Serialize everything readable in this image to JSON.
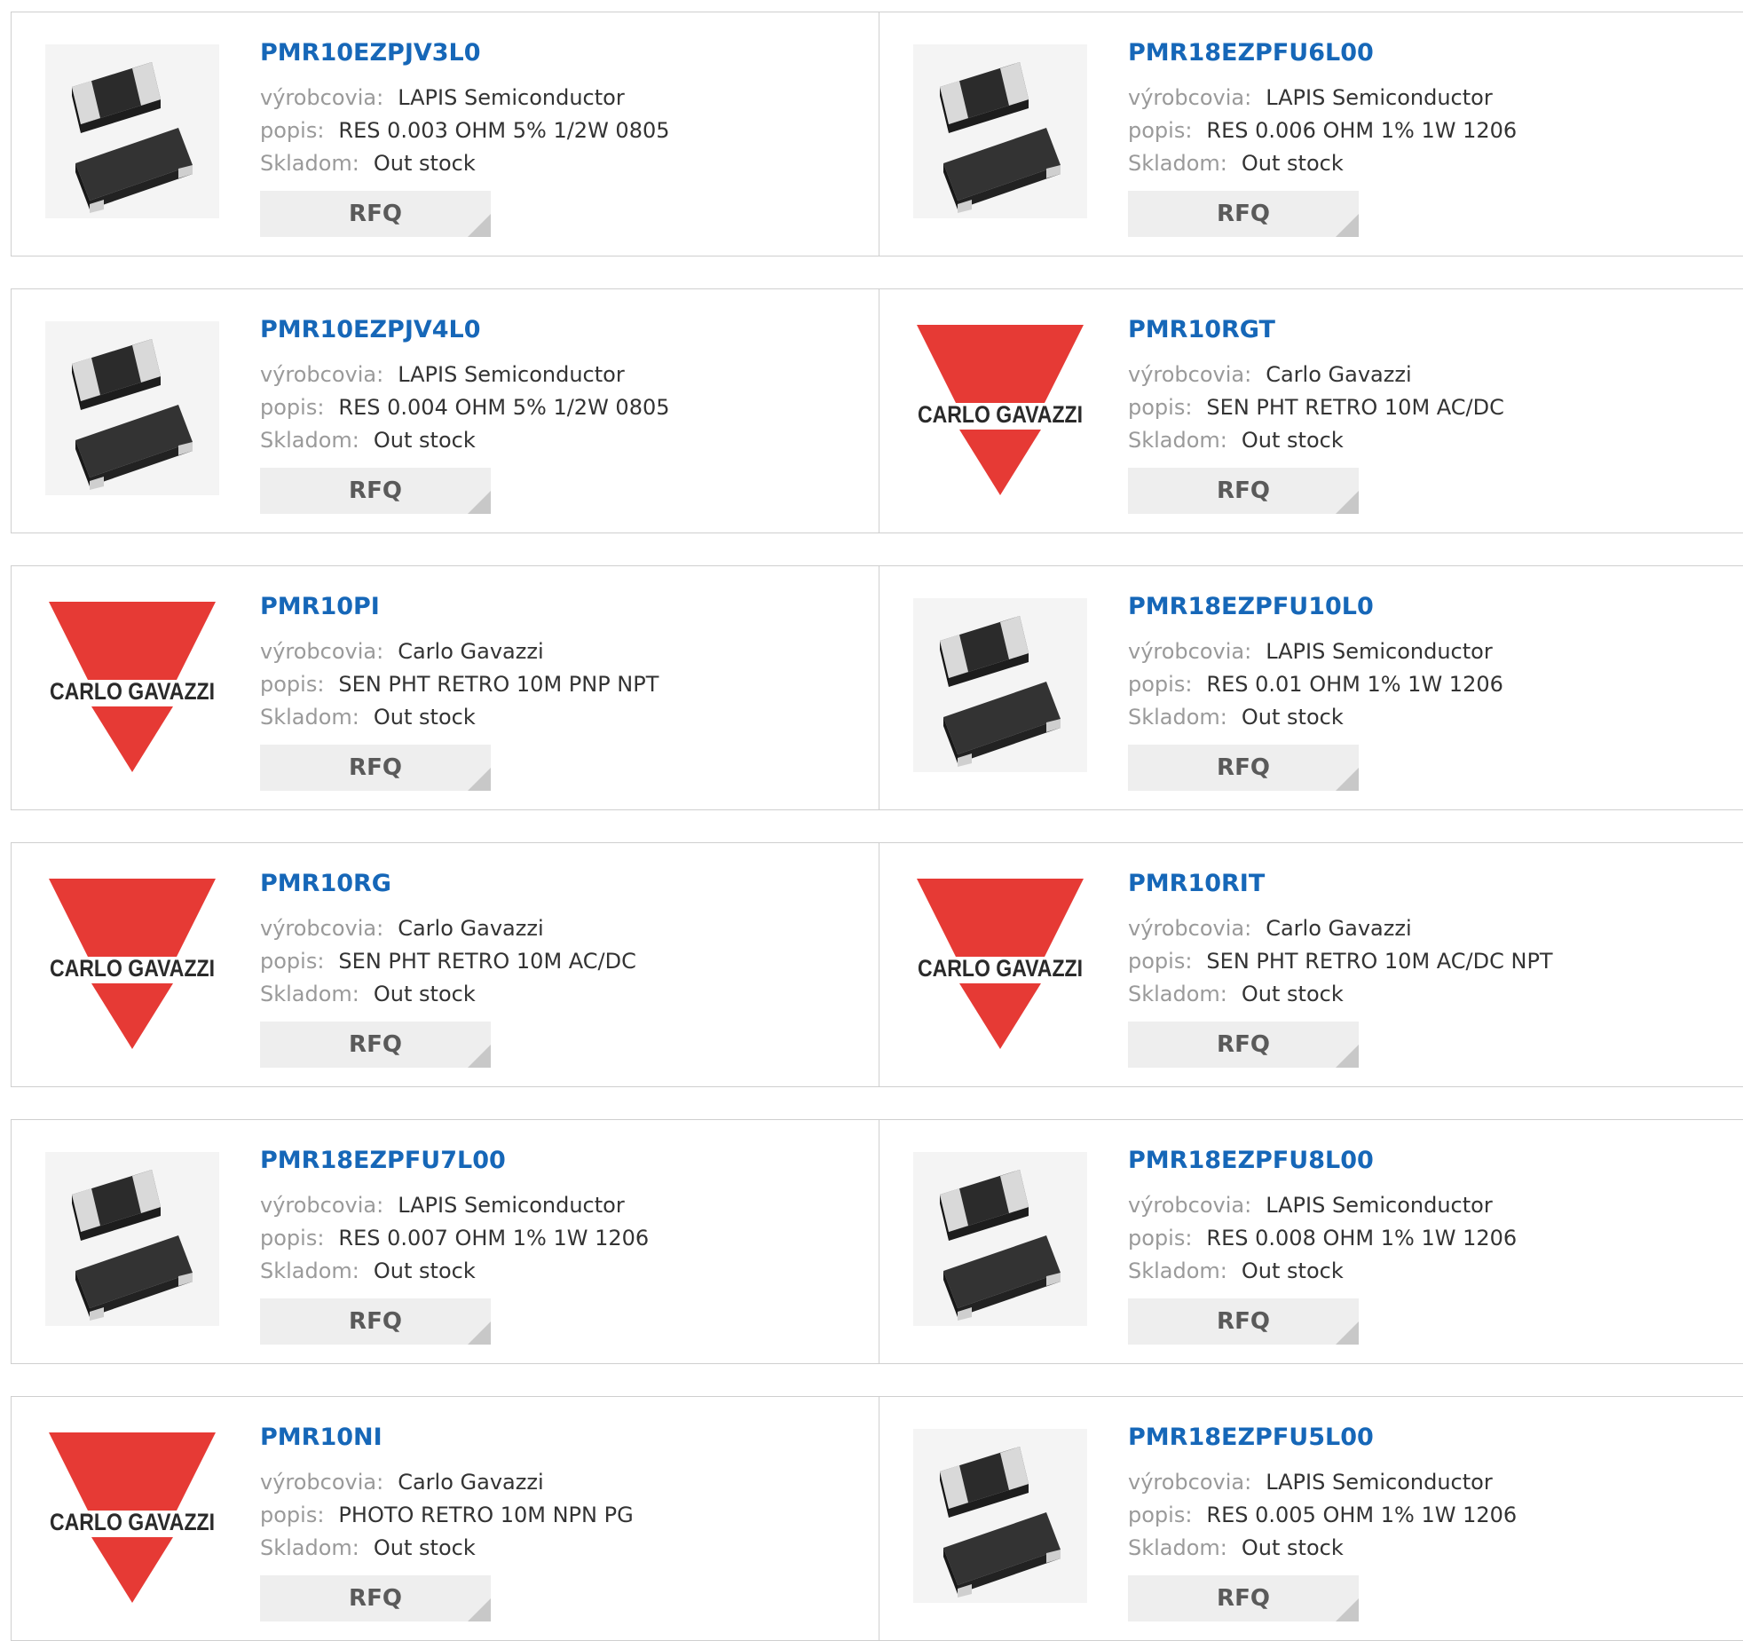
{
  "labels": {
    "manufacturer": "výrobcovia:",
    "description": "popis:",
    "stock": "Skladom:",
    "rfq": "RFQ"
  },
  "brand_colors": {
    "link": "#1667b8",
    "carlo_gavazzi_red": "#e63a35",
    "button_bg": "#eeeeee"
  },
  "products": [
    {
      "part": "PMR10EZPJV3L0",
      "manufacturer": "LAPIS Semiconductor",
      "description": "RES 0.003 OHM 5% 1/2W 0805",
      "stock": "Out stock",
      "image": "smd-resistor-image"
    },
    {
      "part": "PMR18EZPFU6L00",
      "manufacturer": "LAPIS Semiconductor",
      "description": "RES 0.006 OHM 1% 1W 1206",
      "stock": "Out stock",
      "image": "smd-resistor-image"
    },
    {
      "part": "PMR10EZPJV4L0",
      "manufacturer": "LAPIS Semiconductor",
      "description": "RES 0.004 OHM 5% 1/2W 0805",
      "stock": "Out stock",
      "image": "smd-resistor-image"
    },
    {
      "part": "PMR10RGT",
      "manufacturer": "Carlo Gavazzi",
      "description": "SEN PHT RETRO 10M AC/DC",
      "stock": "Out stock",
      "image": "carlo-gavazzi-logo",
      "logo_text": "CARLO GAVAZZI"
    },
    {
      "part": "PMR10PI",
      "manufacturer": "Carlo Gavazzi",
      "description": "SEN PHT RETRO 10M PNP NPT",
      "stock": "Out stock",
      "image": "carlo-gavazzi-logo",
      "logo_text": "CARLO GAVAZZI"
    },
    {
      "part": "PMR18EZPFU10L0",
      "manufacturer": "LAPIS Semiconductor",
      "description": "RES 0.01 OHM 1% 1W 1206",
      "stock": "Out stock",
      "image": "smd-resistor-image"
    },
    {
      "part": "PMR10RG",
      "manufacturer": "Carlo Gavazzi",
      "description": "SEN PHT RETRO 10M AC/DC",
      "stock": "Out stock",
      "image": "carlo-gavazzi-logo",
      "logo_text": "CARLO GAVAZZI"
    },
    {
      "part": "PMR10RIT",
      "manufacturer": "Carlo Gavazzi",
      "description": "SEN PHT RETRO 10M AC/DC NPT",
      "stock": "Out stock",
      "image": "carlo-gavazzi-logo",
      "logo_text": "CARLO GAVAZZI"
    },
    {
      "part": "PMR18EZPFU7L00",
      "manufacturer": "LAPIS Semiconductor",
      "description": "RES 0.007 OHM 1% 1W 1206",
      "stock": "Out stock",
      "image": "smd-resistor-image"
    },
    {
      "part": "PMR18EZPFU8L00",
      "manufacturer": "LAPIS Semiconductor",
      "description": "RES 0.008 OHM 1% 1W 1206",
      "stock": "Out stock",
      "image": "smd-resistor-image"
    },
    {
      "part": "PMR10NI",
      "manufacturer": "Carlo Gavazzi",
      "description": "PHOTO RETRO 10M NPN PG",
      "stock": "Out stock",
      "image": "carlo-gavazzi-logo",
      "logo_text": "CARLO GAVAZZI"
    },
    {
      "part": "PMR18EZPFU5L00",
      "manufacturer": "LAPIS Semiconductor",
      "description": "RES 0.005 OHM 1% 1W 1206",
      "stock": "Out stock",
      "image": "smd-resistor-image"
    }
  ]
}
